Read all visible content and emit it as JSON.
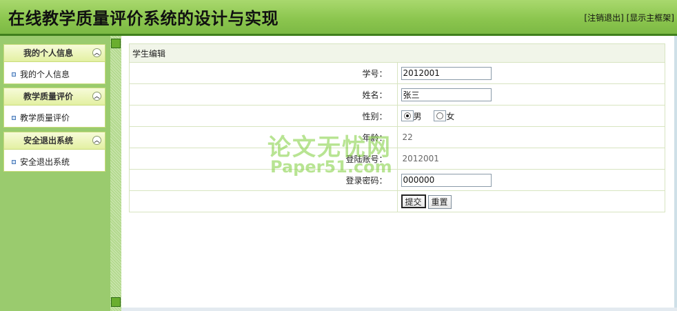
{
  "header": {
    "title": "在线教学质量评价系统的设计与实现",
    "logout_link": "[注销退出]",
    "show_frame_link": "[显示主框架]"
  },
  "sidebar": {
    "groups": [
      {
        "title": "我的个人信息",
        "item": "我的个人信息"
      },
      {
        "title": "教学质量评价",
        "item": "教学质量评价"
      },
      {
        "title": "安全退出系统",
        "item": "安全退出系统"
      }
    ]
  },
  "form": {
    "caption": "学生编辑",
    "student_id_label": "学号：",
    "student_id_value": "2012001",
    "name_label": "姓名：",
    "name_value": "张三",
    "gender_label": "性别：",
    "gender_male": "男",
    "gender_female": "女",
    "gender_selected": "男",
    "age_label": "年龄：",
    "age_value": "22",
    "account_label": "登陆账号：",
    "account_value": "2012001",
    "password_label": "登录密码：",
    "password_value": "000000",
    "submit_label": "提交",
    "reset_label": "重置"
  },
  "watermark": {
    "cn": "论文无忧网",
    "en": "Paper51.com"
  },
  "colors": {
    "header_green": "#8cc64f",
    "header_border": "#3f7f1c",
    "sidebar_green": "#9acb6e",
    "menu_head_yellow": "#e3f0a2"
  }
}
